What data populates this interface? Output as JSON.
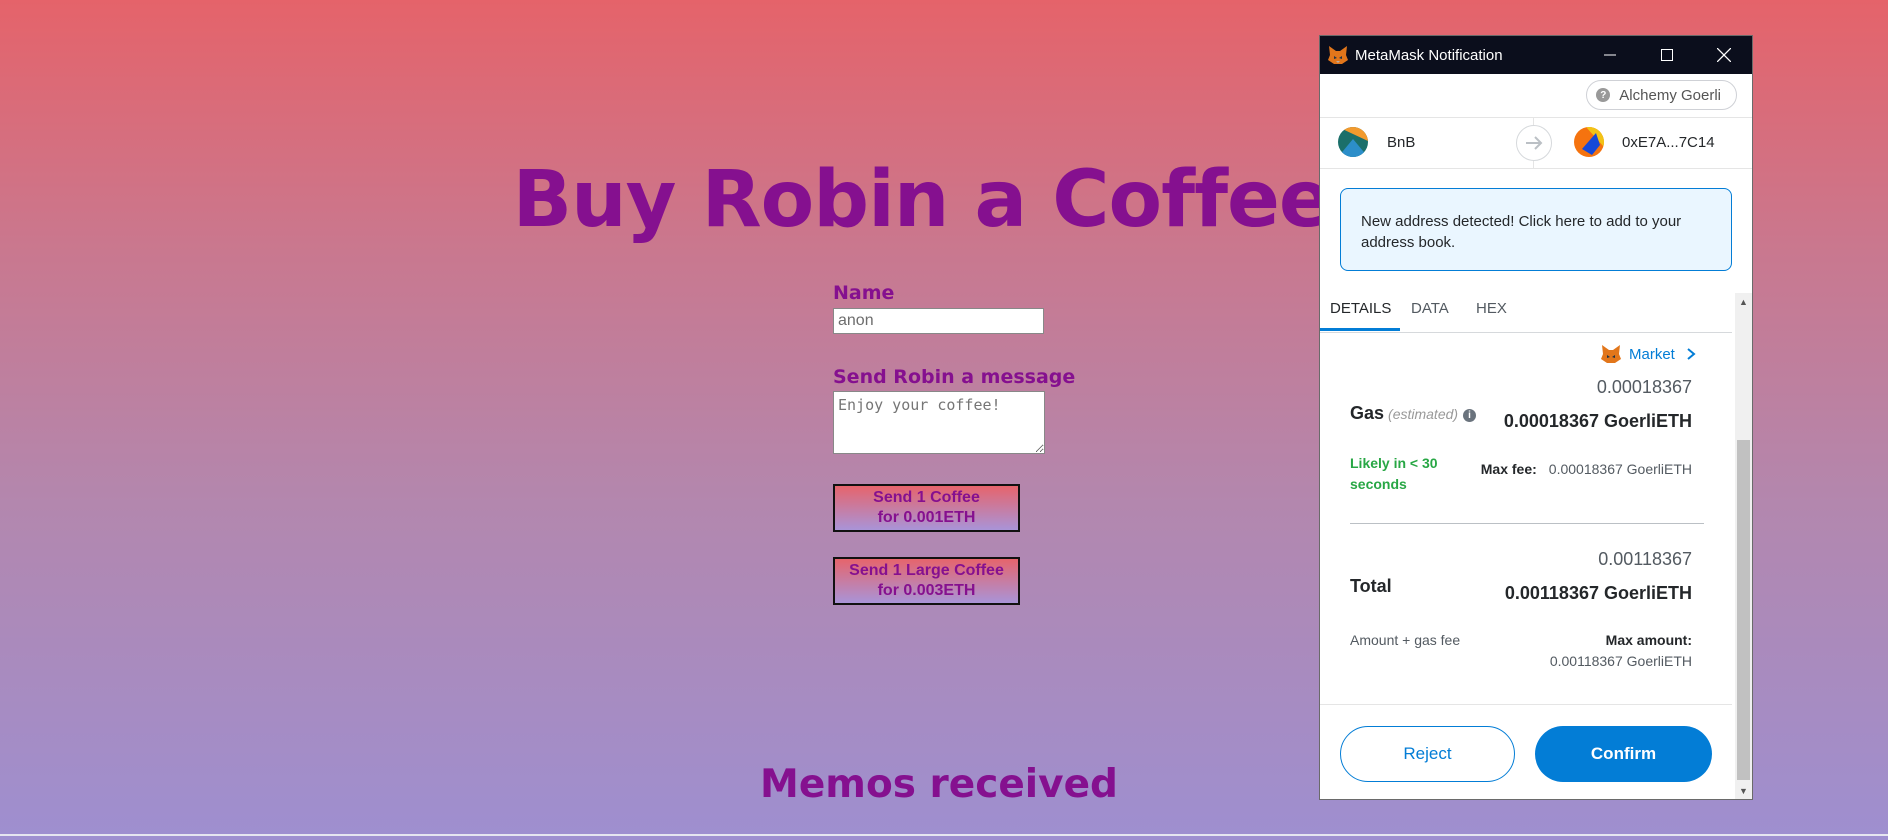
{
  "page": {
    "title": "Buy Robin a Coffee!",
    "name_label": "Name",
    "name_value": "anon",
    "message_label": "Send Robin a message",
    "message_placeholder": "Enjoy your coffee!",
    "coffee_button": [
      "Send 1 Coffee",
      "for 0.001ETH"
    ],
    "large_coffee_button": [
      "Send 1 Large Coffee",
      "for 0.003ETH"
    ],
    "memos_title": "Memos received"
  },
  "metamask": {
    "window_title": "MetaMask Notification",
    "network": "Alchemy Goerli",
    "from_account": "BnB",
    "to_account": "0xE7A...7C14",
    "alert": "New address detected! Click here to add to your address book.",
    "tabs": [
      "DETAILS",
      "DATA",
      "HEX"
    ],
    "active_tab": "DETAILS",
    "market_link": "Market",
    "gas": {
      "label": "Gas",
      "estimated": "(estimated)",
      "value_small": "0.00018367",
      "value_bold": "0.00018367 GoerliETH",
      "likely": "Likely in < 30 seconds",
      "max_fee_label": "Max fee:",
      "max_fee_value": "0.00018367 GoerliETH"
    },
    "total": {
      "label": "Total",
      "value_small": "0.00118367",
      "value_bold": "0.00118367 GoerliETH",
      "amount_gas": "Amount + gas fee",
      "max_amount_label": "Max amount:",
      "max_amount_value": "0.00118367 GoerliETH"
    },
    "reject": "Reject",
    "confirm": "Confirm"
  },
  "colors": {
    "accent": "#037dd6",
    "title_purple": "#85108f",
    "success": "#28a745"
  }
}
